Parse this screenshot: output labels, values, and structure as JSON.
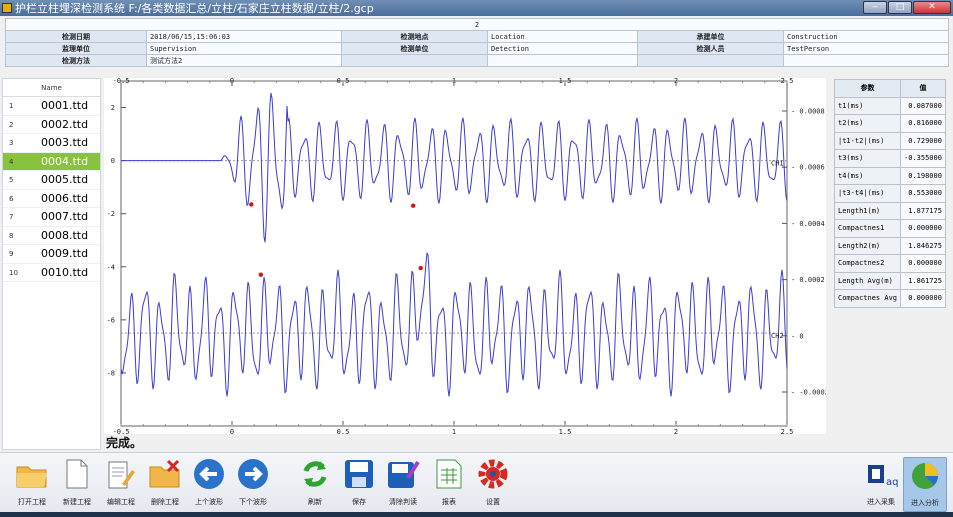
{
  "window": {
    "title": "护栏立柱埋深检测系统  F:/各类数据汇总/立柱/石家庄立柱数据/立柱/2.gcp",
    "minimize": "‒",
    "maximize": "□",
    "close": "✕"
  },
  "info": {
    "header": "2",
    "rows": [
      [
        {
          "label": "检测日期",
          "value": "2018/06/15,15:06:03"
        },
        {
          "label": "检测地点",
          "value": "Location"
        },
        {
          "label": "承建单位",
          "value": "Construction"
        }
      ],
      [
        {
          "label": "监理单位",
          "value": "Supervision"
        },
        {
          "label": "检测单位",
          "value": "Detection"
        },
        {
          "label": "检测人员",
          "value": "TestPerson"
        }
      ],
      [
        {
          "label": "检测方法",
          "value": "测试方法2"
        },
        {
          "label": "",
          "value": ""
        },
        {
          "label": "",
          "value": ""
        }
      ]
    ]
  },
  "filelist": {
    "header": "Name",
    "items": [
      {
        "num": "1",
        "name": "0001.ttd"
      },
      {
        "num": "2",
        "name": "0002.ttd"
      },
      {
        "num": "3",
        "name": "0003.ttd"
      },
      {
        "num": "4",
        "name": "0004.ttd",
        "selected": true
      },
      {
        "num": "5",
        "name": "0005.ttd"
      },
      {
        "num": "6",
        "name": "0006.ttd"
      },
      {
        "num": "7",
        "name": "0007.ttd"
      },
      {
        "num": "8",
        "name": "0008.ttd"
      },
      {
        "num": "9",
        "name": "0009.ttd"
      },
      {
        "num": "10",
        "name": "0010.ttd"
      }
    ]
  },
  "status": "完成。",
  "params": {
    "header": [
      "参数",
      "值"
    ],
    "rows": [
      [
        "t1(ms)",
        "0.087000"
      ],
      [
        "t2(ms)",
        "0.816000"
      ],
      [
        "|t1-t2|(ms)",
        "0.729000"
      ],
      [
        "t3(ms)",
        "-0.355000"
      ],
      [
        "t4(ms)",
        "0.198000"
      ],
      [
        "|t3-t4|(ms)",
        "0.553000"
      ],
      [
        "Length1(m)",
        "1.877175"
      ],
      [
        "Compactnes1",
        "0.000000"
      ],
      [
        "Length2(m)",
        "1.846275"
      ],
      [
        "Compactnes2",
        "0.000000"
      ],
      [
        "Length Avg(m)",
        "1.861725"
      ],
      [
        "Compactnes Avg",
        "0.000000"
      ]
    ]
  },
  "toolbar": {
    "left": [
      {
        "label": "打开工程",
        "icon": "folder-open-icon"
      },
      {
        "label": "新建工程",
        "icon": "new-document-icon"
      },
      {
        "label": "编辑工程",
        "icon": "edit-document-icon"
      },
      {
        "label": "删除工程",
        "icon": "delete-folder-icon"
      },
      {
        "label": "上个波形",
        "icon": "arrow-left-icon"
      },
      {
        "label": "下个波形",
        "icon": "arrow-right-icon"
      },
      {
        "label": "刷新",
        "icon": "refresh-icon"
      },
      {
        "label": "保存",
        "icon": "save-icon"
      },
      {
        "label": "清除判读",
        "icon": "clear-save-icon"
      },
      {
        "label": "报表",
        "icon": "report-icon"
      },
      {
        "label": "设置",
        "icon": "settings-gear-icon"
      }
    ],
    "right": [
      {
        "label": "进入采集",
        "icon": "acquire-icon"
      },
      {
        "label": "进入分析",
        "icon": "analysis-pie-icon",
        "active": true
      }
    ]
  },
  "chart_data": {
    "type": "line",
    "x_ticks": [
      "-0.5",
      "0",
      "0.5",
      "1",
      "1.5",
      "2",
      "2.5"
    ],
    "xlim": [
      -0.5,
      2.5
    ],
    "y_left_ticks": [
      "2",
      "0",
      "-2",
      "-4",
      "-6",
      "-8"
    ],
    "ylim_left": [
      -10,
      3
    ],
    "y_right_ticks": [
      "0.0008",
      "0.0006",
      "0.0004",
      "0.0002",
      "0",
      "-0.0002"
    ],
    "series": [
      {
        "name": "CH1",
        "baseline": 0,
        "color": "#3b3bd8",
        "markers": [
          {
            "x": 0.087,
            "y": -1.65
          },
          {
            "x": 0.816,
            "y": -1.7
          }
        ]
      },
      {
        "name": "CH2",
        "baseline": -6.5,
        "color": "#3b3bd8",
        "markers": [
          {
            "x": 0.13,
            "y": -4.3
          },
          {
            "x": 0.85,
            "y": -4.05
          }
        ]
      }
    ],
    "marker_color": "#e01010"
  }
}
